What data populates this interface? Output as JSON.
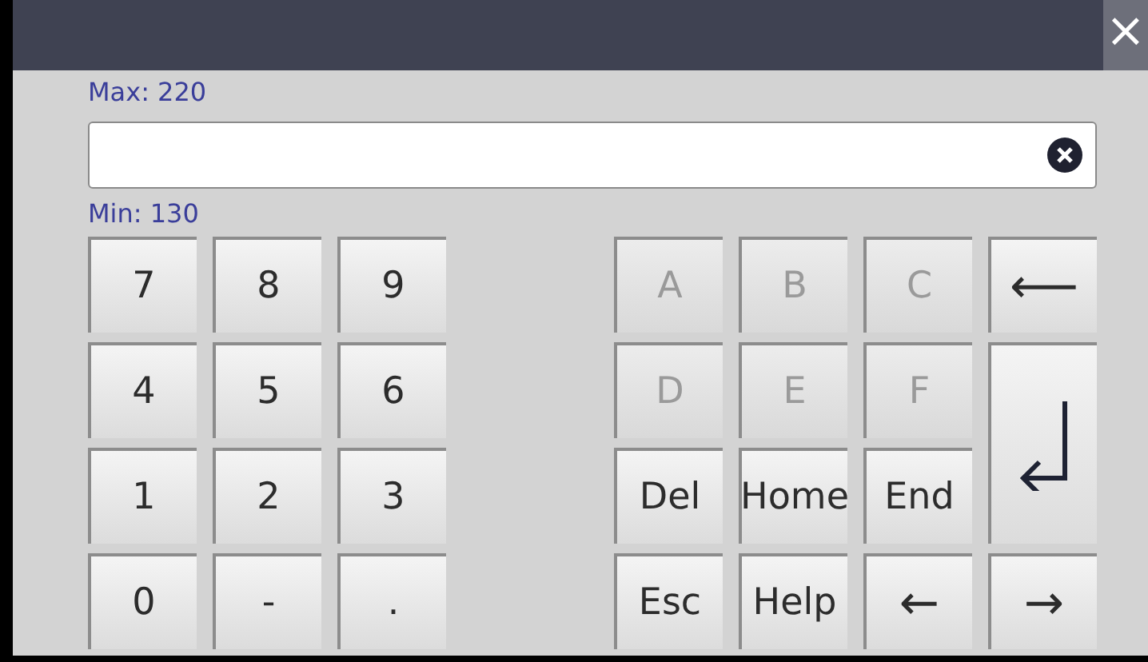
{
  "window": {
    "close": "×"
  },
  "max_label": "Max: 220",
  "min_label": "Min: 130",
  "numpad": [
    {
      "label": "7",
      "kind": "text",
      "disabled": false
    },
    {
      "label": "8",
      "kind": "text",
      "disabled": false
    },
    {
      "label": "9",
      "kind": "text",
      "disabled": false
    },
    {
      "label": "4",
      "kind": "text",
      "disabled": false
    },
    {
      "label": "5",
      "kind": "text",
      "disabled": false
    },
    {
      "label": "6",
      "kind": "text",
      "disabled": false
    },
    {
      "label": "1",
      "kind": "text",
      "disabled": false
    },
    {
      "label": "2",
      "kind": "text",
      "disabled": false
    },
    {
      "label": "3",
      "kind": "text",
      "disabled": false
    },
    {
      "label": "0",
      "kind": "text",
      "disabled": false
    },
    {
      "label": "-",
      "kind": "text",
      "disabled": false
    },
    {
      "label": ".",
      "kind": "text",
      "disabled": false
    }
  ],
  "keypad": [
    {
      "label": "A",
      "kind": "text",
      "disabled": true
    },
    {
      "label": "B",
      "kind": "text",
      "disabled": true
    },
    {
      "label": "C",
      "kind": "text",
      "disabled": true
    },
    {
      "label": "⟵",
      "kind": "text",
      "disabled": false
    },
    {
      "label": "D",
      "kind": "text",
      "disabled": true
    },
    {
      "label": "E",
      "kind": "text",
      "disabled": true
    },
    {
      "label": "F",
      "kind": "text",
      "disabled": true
    },
    {
      "kind": "enter",
      "disabled": false
    },
    {
      "label": "Del",
      "kind": "text",
      "disabled": false
    },
    {
      "label": "Home",
      "kind": "text",
      "disabled": false
    },
    {
      "label": "End",
      "kind": "text",
      "disabled": false
    },
    {
      "label": "Esc",
      "kind": "text",
      "disabled": false
    },
    {
      "label": "Help",
      "kind": "text",
      "disabled": false
    },
    {
      "label": "←",
      "kind": "text",
      "disabled": false
    },
    {
      "label": "→",
      "kind": "text",
      "disabled": false
    }
  ]
}
